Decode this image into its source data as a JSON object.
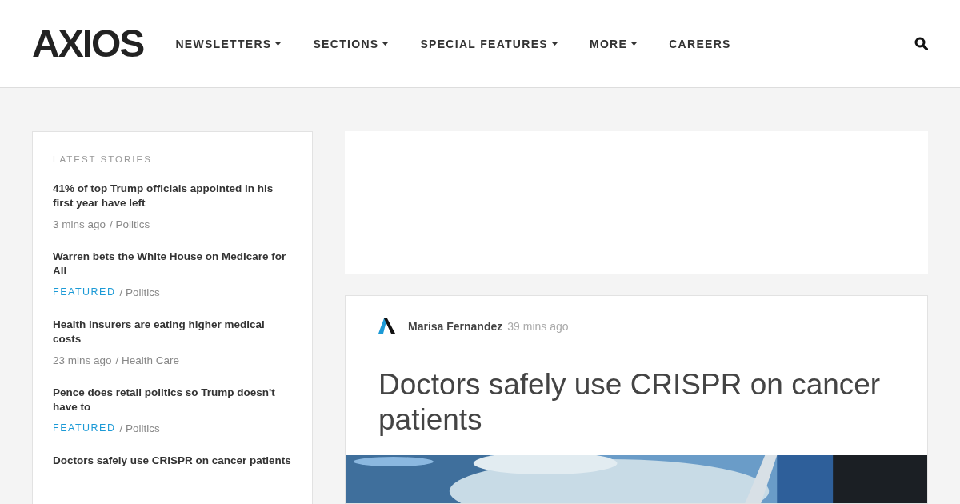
{
  "header": {
    "logo": "AXIOS",
    "nav": [
      {
        "label": "NEWSLETTERS",
        "dropdown": true
      },
      {
        "label": "SECTIONS",
        "dropdown": true
      },
      {
        "label": "SPECIAL FEATURES",
        "dropdown": true
      },
      {
        "label": "MORE",
        "dropdown": true
      },
      {
        "label": "CAREERS",
        "dropdown": false
      }
    ]
  },
  "sidebar": {
    "title": "LATEST STORIES",
    "stories": [
      {
        "headline": "41% of top Trump officials appointed in his first year have left",
        "tag": "3 mins ago",
        "kind": "time",
        "section": "/ Politics"
      },
      {
        "headline": "Warren bets the White House on Medicare for All",
        "tag": "FEATURED",
        "kind": "featured",
        "section": "/ Politics"
      },
      {
        "headline": "Health insurers are eating higher medical costs",
        "tag": "23 mins ago",
        "kind": "time",
        "section": "/ Health Care"
      },
      {
        "headline": "Pence does retail politics so Trump doesn't have to",
        "tag": "FEATURED",
        "kind": "featured",
        "section": "/ Politics"
      },
      {
        "headline": "Doctors safely use CRISPR on cancer patients",
        "kind": "none"
      }
    ]
  },
  "article": {
    "author": "Marisa Fernandez",
    "time": "39 mins ago",
    "headline": "Doctors safely use CRISPR on cancer patients"
  }
}
